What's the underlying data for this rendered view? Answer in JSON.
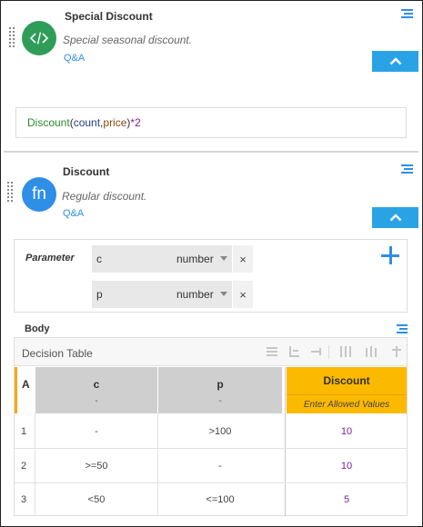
{
  "card1": {
    "title": "Special Discount",
    "description": "Special seasonal discount.",
    "qa_link": "Q&A",
    "avatar_icon": "code-icon",
    "expression": {
      "fn": "Discount",
      "open": "(",
      "arg1": "count",
      "comma": ",",
      "arg2": "price",
      "close": ")",
      "op": "*",
      "num": "2"
    }
  },
  "card2": {
    "title": "Discount",
    "description": "Regular discount.",
    "qa_link": "Q&A",
    "avatar_label": "fn",
    "params_label": "Parameter",
    "parameters": [
      {
        "name": "c",
        "type": "number",
        "remove": "×"
      },
      {
        "name": "p",
        "type": "number",
        "remove": "×"
      }
    ],
    "body_label": "Body",
    "decision_table": {
      "title": "Decision Table",
      "hit_policy": "A",
      "inputs": [
        {
          "name": "c",
          "allowed": "-"
        },
        {
          "name": "p",
          "allowed": "-"
        }
      ],
      "output": {
        "name": "Discount",
        "allowed": "Enter Allowed Values"
      },
      "rows": [
        {
          "n": "1",
          "c": "-",
          "p": ">100",
          "out": "10"
        },
        {
          "n": "2",
          "c": ">=50",
          "p": "-",
          "out": "10"
        },
        {
          "n": "3",
          "c": "<50",
          "p": "<=100",
          "out": "5"
        }
      ]
    }
  },
  "colors": {
    "accent": "#2f8ee6",
    "collapse_button": "#2aa3e6",
    "avatar_green": "#2f9d58",
    "output_header": "#fbb900",
    "input_header": "#cfcfcf",
    "output_value": "#7a1fa2"
  }
}
